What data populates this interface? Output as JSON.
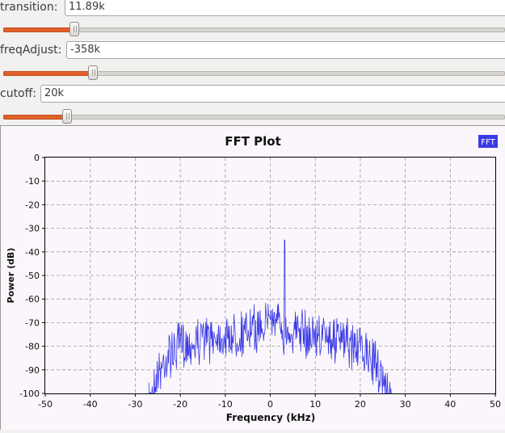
{
  "controls": [
    {
      "key": "transition",
      "label": "transition:",
      "value": "11.89k",
      "slider_fraction": 0.142
    },
    {
      "key": "freqAdjust",
      "label": "freqAdjust:",
      "value": "-358k",
      "slider_fraction": 0.178
    },
    {
      "key": "cutoff",
      "label": "cutoff:",
      "value": "20k",
      "slider_fraction": 0.128
    }
  ],
  "colors": {
    "slider_fill": "#e0602c",
    "trace": "#3b3be6",
    "grid": "#9a9a9a",
    "plot_bg": "#fbf6fb"
  },
  "chart_data": {
    "type": "line",
    "title": "FFT Plot",
    "xlabel": "Frequency (kHz)",
    "ylabel": "Power (dB)",
    "xlim": [
      -50,
      50
    ],
    "ylim": [
      -100,
      0
    ],
    "xticks": [
      -50,
      -40,
      -30,
      -20,
      -10,
      0,
      10,
      20,
      30,
      40,
      50
    ],
    "yticks": [
      0,
      -10,
      -20,
      -30,
      -40,
      -50,
      -60,
      -70,
      -80,
      -90,
      -100
    ],
    "grid": true,
    "legend_position": "top-right",
    "series": [
      {
        "name": "FFT",
        "color": "#3b3be6",
        "envelope_x": [
          -27,
          -25,
          -23,
          -21,
          -19,
          -17,
          -15,
          -13,
          -11,
          -9,
          -7,
          -5,
          -3,
          -1,
          0,
          1,
          3,
          5,
          7,
          9,
          11,
          13,
          15,
          17,
          19,
          21,
          23,
          25,
          26,
          27
        ],
        "envelope_y": [
          -100,
          -84,
          -78,
          -75,
          -73,
          -72,
          -70,
          -70,
          -69,
          -69,
          -68,
          -67,
          -66,
          -62,
          -60,
          -63,
          -66,
          -67,
          -68,
          -69,
          -69,
          -70,
          -71,
          -72,
          -74,
          -76,
          -80,
          -86,
          -93,
          -100
        ],
        "peaks": [
          {
            "x": 3.2,
            "y": -35
          }
        ]
      }
    ]
  }
}
